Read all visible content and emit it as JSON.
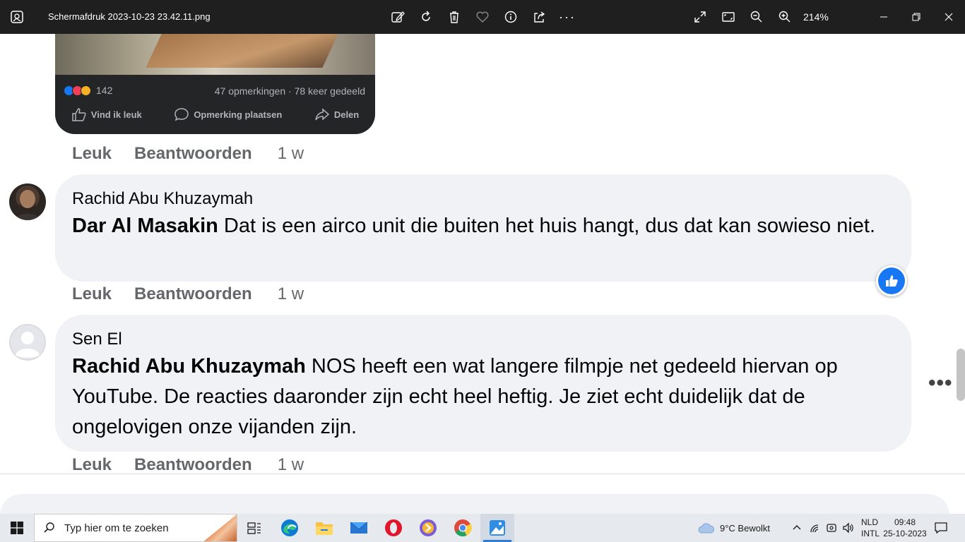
{
  "window": {
    "title": "Schermafdruk 2023-10-23 23.42.11.png",
    "zoom": "214%",
    "toolbar_icons": [
      "edit-icon",
      "rotate-icon",
      "delete-icon",
      "favorite-icon",
      "info-icon",
      "share-icon",
      "more-icon"
    ],
    "view_icons": [
      "fullscreen-icon",
      "fit-icon",
      "zoom-out-icon",
      "zoom-in-icon"
    ]
  },
  "post": {
    "reaction_count": "142",
    "stats": "47 opmerkingen · 78 keer gedeeld",
    "actions": [
      "Vind ik leuk",
      "Opmerking plaatsen",
      "Delen"
    ]
  },
  "meta_labels": {
    "like": "Leuk",
    "reply": "Beantwoorden"
  },
  "comments": [
    {
      "time": "1 w"
    },
    {
      "author": "Rachid Abu Khuzaymah",
      "tag": "Dar Al Masakin",
      "text": " Dat is een airco unit die buiten het huis hangt, dus dat kan sowieso niet.",
      "time": "1 w"
    },
    {
      "author": "Sen El",
      "tag": "Rachid Abu Khuzaymah",
      "text": " NOS heeft een wat langere filmpje net gedeeld hiervan op YouTube. De reacties daaronder zijn echt heel heftig. Je ziet echt duidelijk dat de ongelovigen onze vijanden zijn.",
      "time": "1 w"
    }
  ],
  "more_label": "•••",
  "colors": {
    "like_blue": "#1877f2",
    "bubble": "#f0f2f5",
    "titlebar": "#1f1f1f"
  },
  "taskbar": {
    "search_placeholder": "Typ hier om te zoeken",
    "apps": [
      "task-view-icon",
      "edge-icon",
      "file-explorer-icon",
      "mail-icon",
      "opera-icon",
      "browser-icon",
      "chrome-icon",
      "photos-icon"
    ],
    "weather": "9°C  Bewolkt",
    "lang_top": "NLD",
    "lang_bottom": "INTL",
    "time": "09:48",
    "date": "25-10-2023"
  }
}
